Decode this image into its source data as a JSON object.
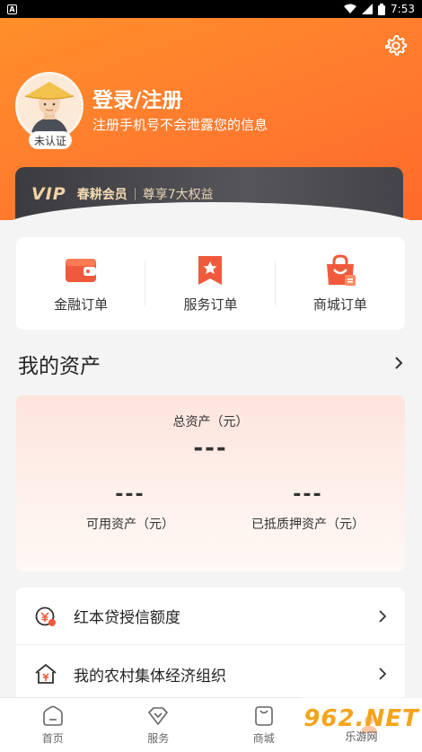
{
  "status_bar": {
    "time": "7:53",
    "app_icon_letter": "A"
  },
  "header": {
    "login_title": "登录/注册",
    "login_subtitle": "注册手机号不会泄露您的信息",
    "unverified_badge": "未认证",
    "settings_icon": "gear-icon"
  },
  "vip": {
    "logo": "VIP",
    "name": "春耕会员",
    "benefit": "尊享7大权益"
  },
  "orders": [
    {
      "label": "金融订单",
      "icon": "wallet-icon"
    },
    {
      "label": "服务订单",
      "icon": "star-bookmark-icon"
    },
    {
      "label": "商城订单",
      "icon": "shopping-bag-icon"
    }
  ],
  "assets": {
    "title": "我的资产",
    "total_label": "总资产（元）",
    "total_value": "---",
    "available_label": "可用资产（元）",
    "available_value": "---",
    "pledged_label": "已抵质押资产（元）",
    "pledged_value": "---"
  },
  "list": [
    {
      "label": "红本贷授信额度",
      "icon": "credit-icon"
    },
    {
      "label": "我的农村集体经济组织",
      "icon": "house-icon"
    }
  ],
  "tabbar": [
    {
      "label": "首页",
      "icon": "home-icon"
    },
    {
      "label": "服务",
      "icon": "service-icon"
    },
    {
      "label": "商城",
      "icon": "mall-icon"
    },
    {
      "label": "",
      "icon": "mine-icon"
    }
  ],
  "watermark": {
    "main": "962.NET",
    "sub": "乐游网"
  },
  "colors": {
    "accent": "#ff7a2e",
    "vip_gold": "#f1d3a3",
    "icon_red": "#f05a3c"
  }
}
